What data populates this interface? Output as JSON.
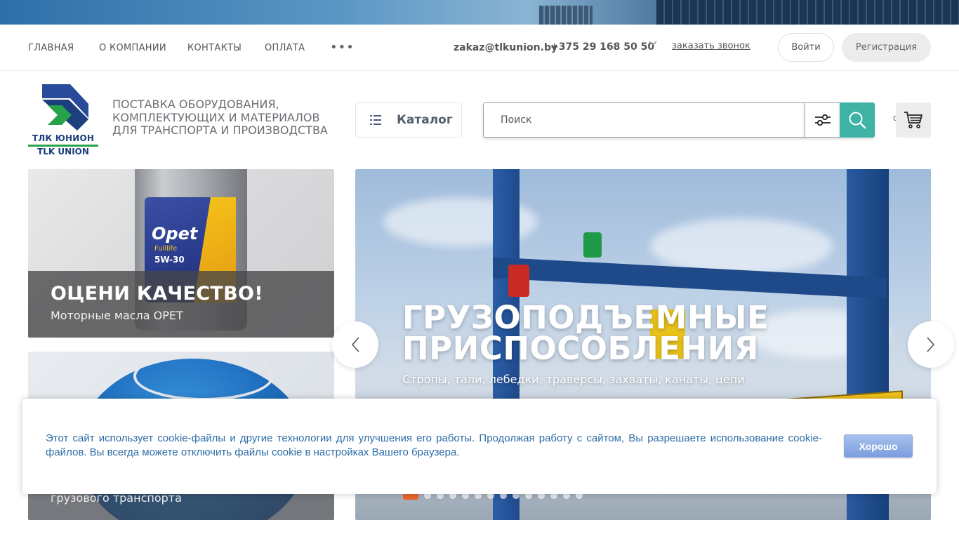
{
  "nav": {
    "items": [
      "ГЛАВНАЯ",
      "О КОМПАНИИ",
      "КОНТАКТЫ",
      "ОПЛАТА"
    ],
    "more": "•••",
    "email": "zakaz@tlkunion.by",
    "phone": "+375 29 168 50 50",
    "callback": "заказать звонок",
    "login": "Войти",
    "register": "Регистрация"
  },
  "header": {
    "logo_text_ru": "ТЛК ЮНИОН",
    "logo_text_en": "TLK UNION",
    "tagline": "ПОСТАВКА ОБОРУДОВАНИЯ, КОМПЛЕКТУЮЩИХ И МАТЕРИАЛОВ ДЛЯ ТРАНСПОРТА И ПРОИЗВОДСТВА",
    "catalog_label": "Каталог",
    "search_placeholder": "Поиск",
    "cart_count": "0"
  },
  "promos": [
    {
      "title": "ОЦЕНИ КАЧЕСТВО!",
      "subtitle": "Моторные масла OPET",
      "product_brand": "Opet",
      "product_line": "Fulllife",
      "product_grade": "5W-30"
    },
    {
      "subtitle": "грузового транспорта"
    }
  ],
  "slider": {
    "title_line1": "ГРУЗОПОДЪЕМНЫЕ",
    "title_line2": "ПРИСПОСОБЛЕНИЯ",
    "subtitle": "Стропы, тали, лебедки, траверсы, захваты, канаты, цепи",
    "slide_count": 14,
    "active_index": 0
  },
  "cookie": {
    "text": "Этот сайт использует cookie-файлы и другие технологии для улучшения его работы. Продолжая работу с сайтом, Вы разрешаете использование cookie-файлов. Вы всегда можете отключить файлы cookie в настройках Вашего браузера.",
    "button": "Хорошо"
  },
  "colors": {
    "accent_teal": "#3fb3a6",
    "slider_active_dot": "#e8652a",
    "cookie_text": "#2d6da8",
    "logo_blue": "#1d3f7e",
    "logo_green": "#27a24a"
  }
}
